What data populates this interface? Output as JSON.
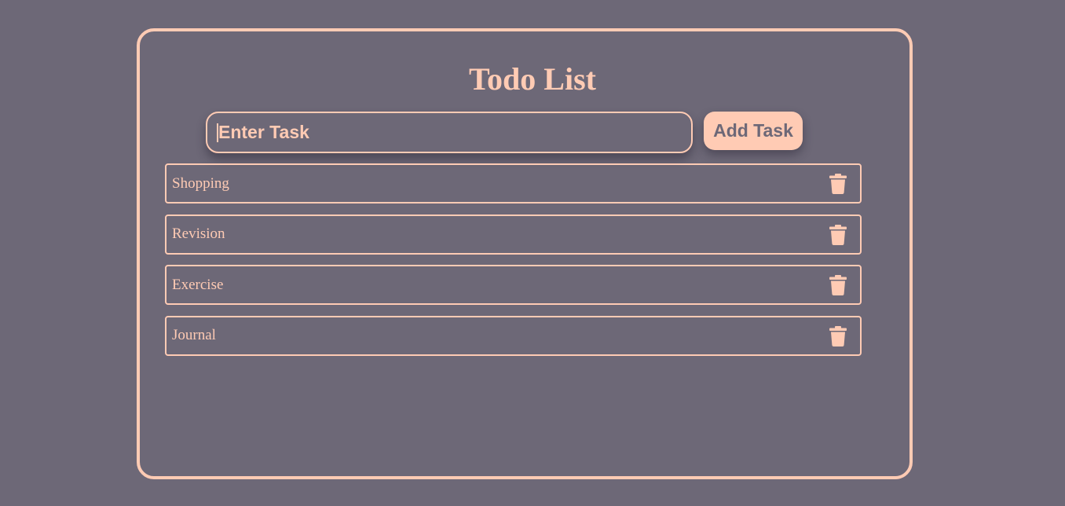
{
  "app": {
    "title": "Todo List"
  },
  "input": {
    "placeholder": "Enter Task",
    "value": ""
  },
  "add_button": {
    "label": "Add Task"
  },
  "tasks": [
    {
      "text": "Shopping",
      "delete_icon": "trash-icon"
    },
    {
      "text": "Revision",
      "delete_icon": "trash-icon"
    },
    {
      "text": "Exercise",
      "delete_icon": "trash-icon"
    },
    {
      "text": "Journal",
      "delete_icon": "trash-icon"
    }
  ],
  "colors": {
    "background": "#6d6877",
    "accent": "#ffcbb4"
  }
}
